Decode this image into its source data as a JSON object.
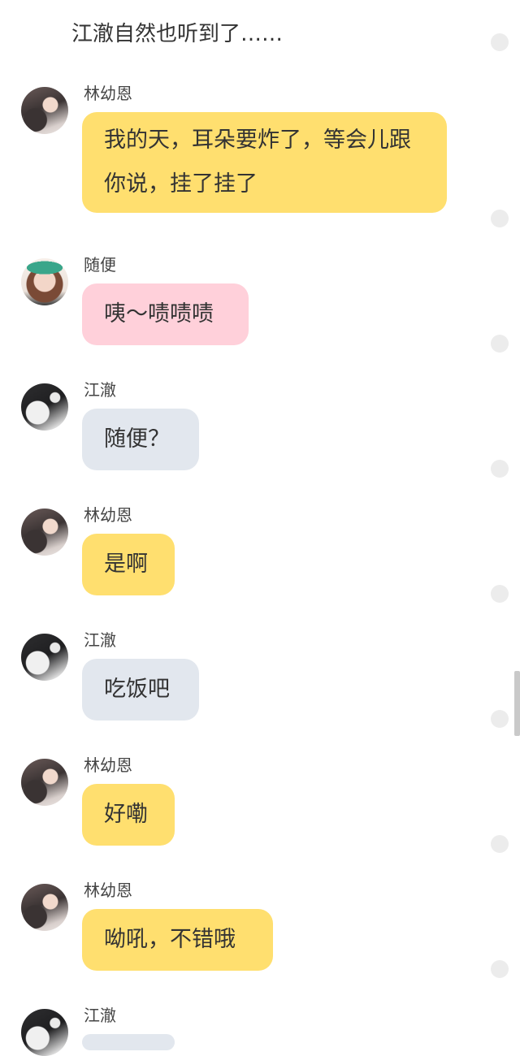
{
  "narration": "江澈自然也听到了……",
  "messages": [
    {
      "sender": "林幼恩",
      "text": "我的天，耳朵要炸了，等会儿跟你说，挂了挂了",
      "avatar": "avatar-linyouen",
      "bubble_color": "#ffdf6f"
    },
    {
      "sender": "随便",
      "text": "咦～啧啧啧",
      "avatar": "avatar-suibian",
      "bubble_color": "#ffd0da"
    },
    {
      "sender": "江澈",
      "text": "随便？",
      "avatar": "avatar-jiangche",
      "bubble_color": "#e2e7ee"
    },
    {
      "sender": "林幼恩",
      "text": "是啊",
      "avatar": "avatar-linyouen",
      "bubble_color": "#ffdf6f"
    },
    {
      "sender": "江澈",
      "text": "吃饭吧",
      "avatar": "avatar-jiangche",
      "bubble_color": "#e2e7ee"
    },
    {
      "sender": "林幼恩",
      "text": "好嘞",
      "avatar": "avatar-linyouen",
      "bubble_color": "#ffdf6f"
    },
    {
      "sender": "林幼恩",
      "text": "呦吼，不错哦",
      "avatar": "avatar-linyouen",
      "bubble_color": "#ffdf6f"
    },
    {
      "sender": "江澈",
      "text": "",
      "avatar": "avatar-jiangche",
      "bubble_color": "#e2e7ee"
    }
  ]
}
